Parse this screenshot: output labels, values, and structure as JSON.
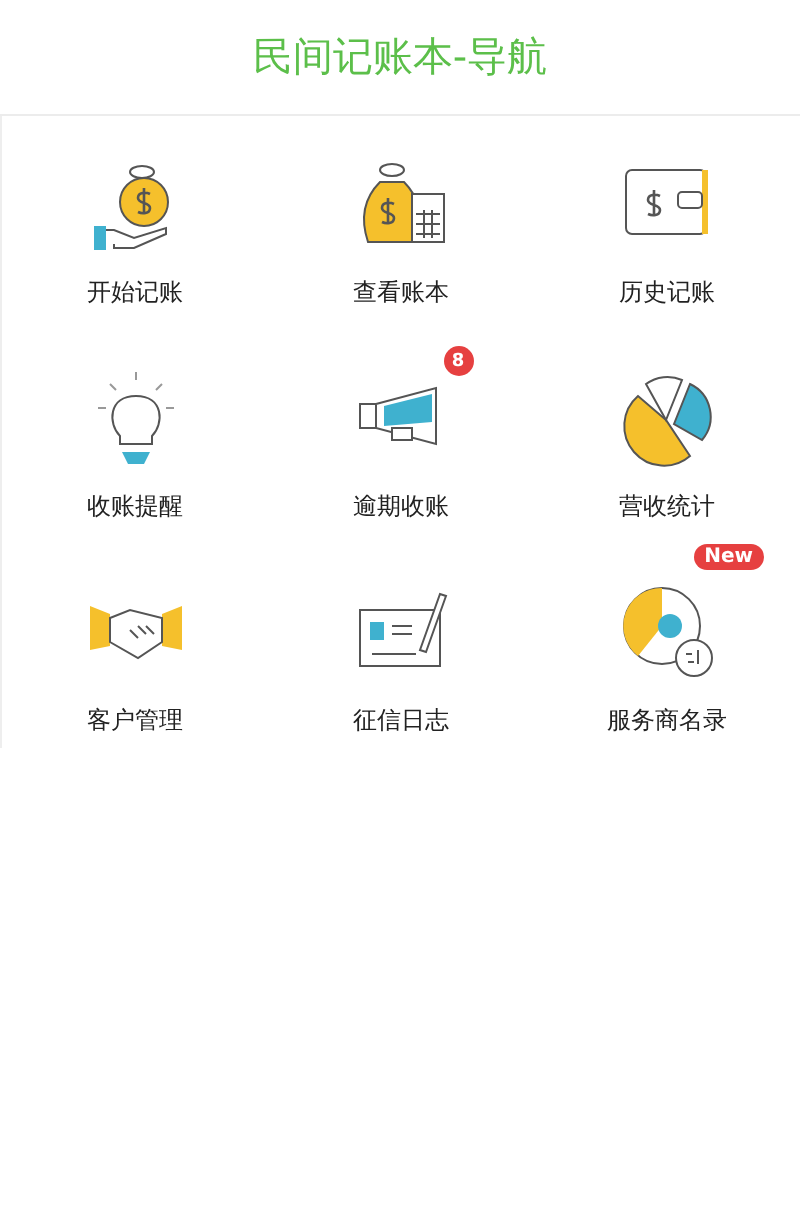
{
  "header": {
    "title": "民间记账本-导航"
  },
  "items": [
    {
      "kind": "hand-money",
      "label": "开始记账"
    },
    {
      "kind": "bag-calculator",
      "label": "查看账本"
    },
    {
      "kind": "wallet",
      "label": "历史记账"
    },
    {
      "kind": "bulb",
      "label": "收账提醒"
    },
    {
      "kind": "megaphone",
      "label": "逾期收账",
      "badge": "8"
    },
    {
      "kind": "pie",
      "label": "营收统计"
    },
    {
      "kind": "handshake",
      "label": "客户管理"
    },
    {
      "kind": "check",
      "label": "征信日志"
    },
    {
      "kind": "clock",
      "label": "服务商名录",
      "tag": "New"
    }
  ]
}
